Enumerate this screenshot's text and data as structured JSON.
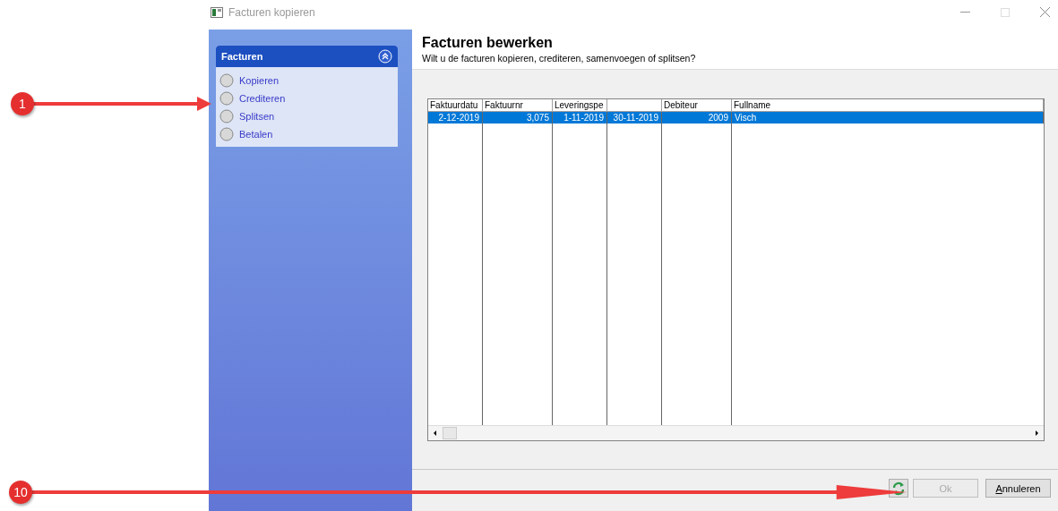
{
  "window": {
    "title": "Facturen kopieren"
  },
  "task_panel": {
    "title": "Facturen",
    "expanded": true,
    "items": [
      {
        "label": "Kopieren",
        "selected": false
      },
      {
        "label": "Crediteren",
        "selected": false
      },
      {
        "label": "Splitsen",
        "selected": false
      },
      {
        "label": "Betalen",
        "selected": false
      }
    ]
  },
  "header": {
    "title": "Facturen bewerken",
    "subtitle": "Wilt u de facturen kopieren, crediteren, samenvoegen of splitsen?"
  },
  "table": {
    "columns": [
      "Faktuurdatu",
      "Faktuurnr",
      "Leveringspe",
      "",
      "Debiteur",
      "Fullname"
    ],
    "rows": [
      {
        "cells": [
          "2-12-2019",
          "3,075",
          "1-11-2019",
          "30-11-2019",
          "2009",
          "Visch"
        ],
        "selected": true
      }
    ]
  },
  "buttons": [
    {
      "kind": "refresh",
      "disabled": false
    },
    {
      "kind": "text",
      "label": "Ok",
      "disabled": true
    },
    {
      "kind": "text",
      "label": "Annuleren",
      "disabled": false
    }
  ],
  "annotations": [
    {
      "label": "1"
    },
    {
      "label": "10"
    }
  ]
}
